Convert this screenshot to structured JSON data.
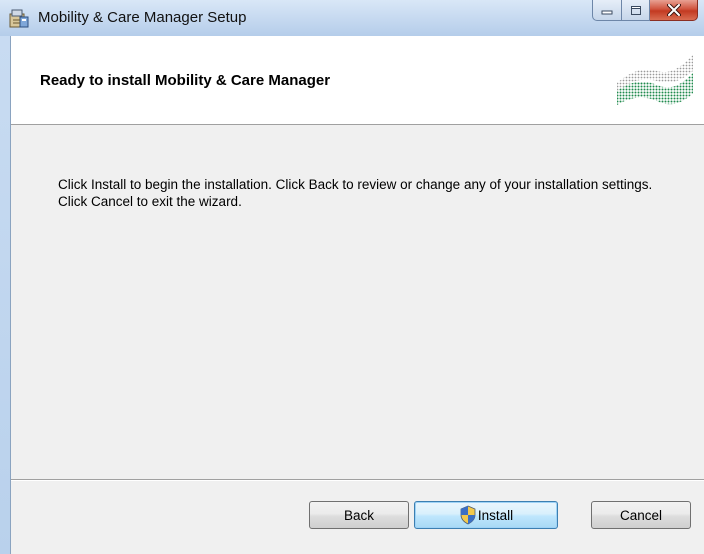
{
  "window": {
    "title": "Mobility & Care Manager Setup",
    "app_icon": "installer-icon"
  },
  "caption_buttons": {
    "minimize": "minimize-icon",
    "maximize": "maximize-icon",
    "close": "close-icon"
  },
  "banner": {
    "title": "Ready to install Mobility & Care Manager",
    "logo_icon": "wave-logo-icon"
  },
  "body": {
    "text": "Click Install to begin the installation. Click Back to review or change any of your installation settings. Click Cancel to exit the wizard."
  },
  "buttons": {
    "back_label": "Back",
    "install_label": "Install",
    "cancel_label": "Cancel"
  },
  "colors": {
    "close_button": "#c33a21",
    "install_button_border": "#3c7fb1",
    "logo_green": "#1f8a4c"
  }
}
